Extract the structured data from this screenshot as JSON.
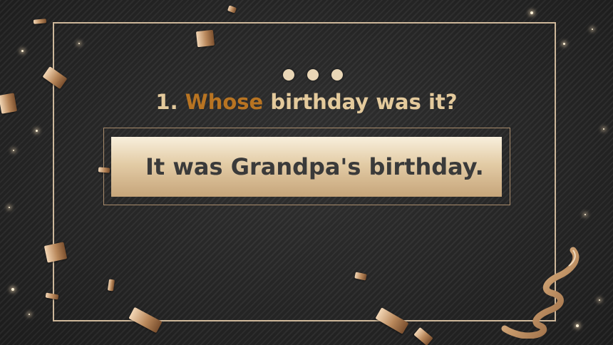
{
  "question": {
    "number": "1.",
    "highlight": "Whose",
    "rest": "birthday was it?"
  },
  "answer": {
    "text": "It was Grandpa's birthday."
  },
  "colors": {
    "background": "#262626",
    "frame": "#cdb79a",
    "question_text": "#e4ca9c",
    "question_highlight": "#b87422",
    "answer_gradient_top": "#f8efdc",
    "answer_gradient_bottom": "#c6a57a",
    "answer_text": "#3a3a3a"
  },
  "decorations": {
    "dots_icon": "three-dots",
    "confetti_icon": "gold-confetti",
    "ribbon_icon": "curled-ribbon"
  }
}
